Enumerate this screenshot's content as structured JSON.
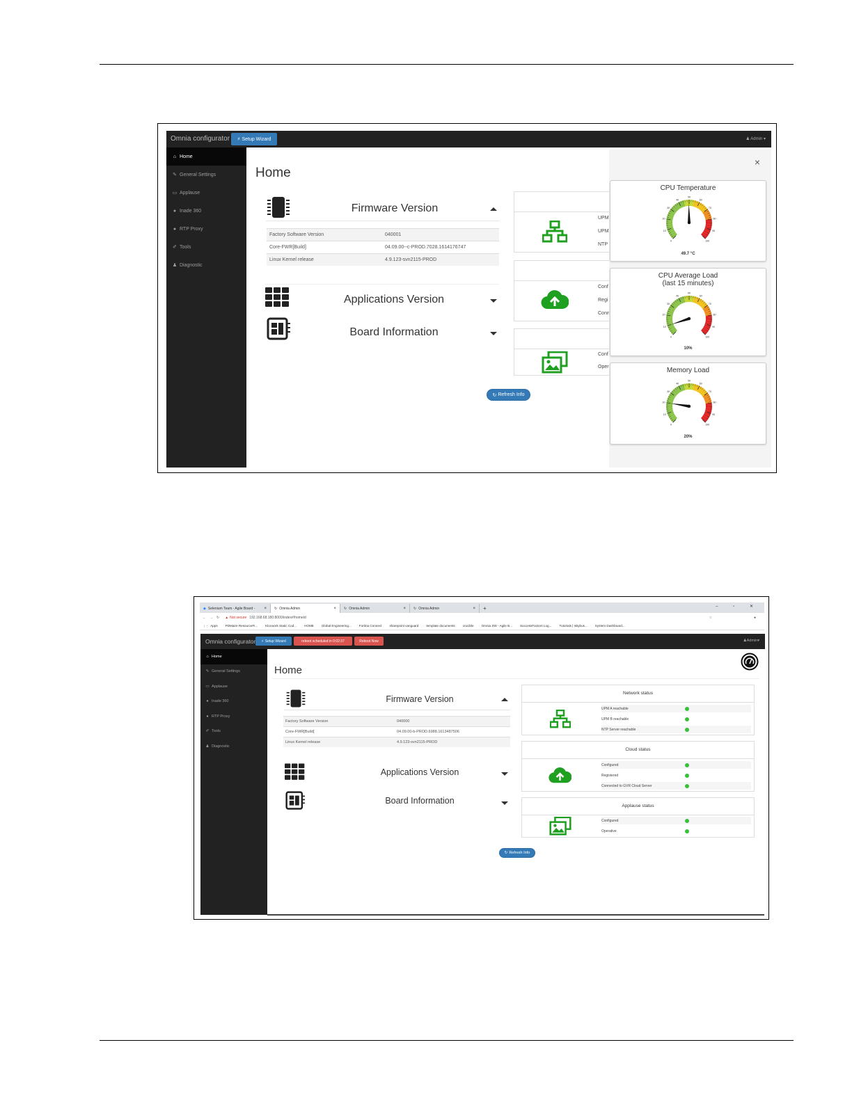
{
  "screenshot1": {
    "brand": "Omnia configurator",
    "setup_wizard": "Setup Wizard",
    "admin": "Admin",
    "sidebar": [
      {
        "label": "Home",
        "icon": "home-icon"
      },
      {
        "label": "General Settings",
        "icon": "wrench-icon"
      },
      {
        "label": "Applause",
        "icon": "monitor-icon"
      },
      {
        "label": "Inade 360",
        "icon": "circle-icon"
      },
      {
        "label": "RTP Proxy",
        "icon": "circle-icon"
      },
      {
        "label": "Tools",
        "icon": "edit-icon"
      },
      {
        "label": "Diagnostic",
        "icon": "user-icon"
      }
    ],
    "page_title": "Home",
    "firmware": {
      "title": "Firmware Version",
      "rows": [
        {
          "key": "Factory Software Version",
          "value": "040001"
        },
        {
          "key": "Core-FWR[Build]",
          "value": "04.09.00--c-PROD.7028.1614176747"
        },
        {
          "key": "Linux Kernel release",
          "value": "4.9.123-svn2115-PROD"
        }
      ]
    },
    "applications_title": "Applications Version",
    "board_title": "Board Information",
    "refresh": "Refresh Info",
    "status_fragments": {
      "network": [
        "UPM",
        "UPM",
        "NTP"
      ],
      "cloud": [
        "Conf",
        "Regi",
        "Conn"
      ],
      "applause": [
        "Conf",
        "Oper"
      ]
    },
    "gauges": [
      {
        "title": "CPU Temperature",
        "subtitle": "",
        "value_label": "49.7 °C",
        "fraction": 0.497,
        "ticks": [
          "0",
          "10",
          "20",
          "30",
          "40",
          "50",
          "60",
          "70",
          "80",
          "90",
          "100"
        ]
      },
      {
        "title": "CPU Average Load",
        "subtitle": "(last 15 minutes)",
        "value_label": "10%",
        "fraction": 0.1,
        "ticks": [
          "0",
          "10",
          "20",
          "30",
          "40",
          "50",
          "60",
          "70",
          "80",
          "90",
          "100"
        ]
      },
      {
        "title": "Memory Load",
        "subtitle": "",
        "value_label": "20%",
        "fraction": 0.2,
        "ticks": [
          "0",
          "10",
          "20",
          "30",
          "40",
          "50",
          "60",
          "70",
          "80",
          "90",
          "100"
        ]
      }
    ],
    "close": "×"
  },
  "screenshot2": {
    "browser_tabs": [
      {
        "label": "Selenium Team - Agile Board -",
        "active": false
      },
      {
        "label": "Omnia Admin",
        "active": true
      },
      {
        "label": "Omnia Admin",
        "active": false
      },
      {
        "label": "Omnia Admin",
        "active": false
      }
    ],
    "new_tab": "+",
    "window_controls": "– ▫ ✕",
    "not_secure": "Not secure",
    "url": "192.168.68.180:8000/index#/homeId",
    "bookmarks": [
      "Apps",
      "PDMaire ResourceFi...",
      "Klocwork Static Cod...",
      "HOME",
      "Global Engineering...",
      "Fortina Connect",
      "sharepoint vanguard",
      "template documents",
      "crucible",
      "Omnia SW - Agile B...",
      "SuccessFactors Log...",
      "Tutorials | nBybus...",
      "System Dashboard..."
    ],
    "brand": "Omnia configurator",
    "setup_wizard": "Setup Wizard",
    "reboot_scheduled": "reboot scheduled in 0:02:37",
    "reboot_now": "Reboot Now",
    "admin": "Admin",
    "sidebar": [
      {
        "label": "Home",
        "icon": "home-icon"
      },
      {
        "label": "General Settings",
        "icon": "wrench-icon"
      },
      {
        "label": "Applause",
        "icon": "monitor-icon"
      },
      {
        "label": "Inade 360",
        "icon": "circle-icon"
      },
      {
        "label": "RTP Proxy",
        "icon": "circle-icon"
      },
      {
        "label": "Tools",
        "icon": "edit-icon"
      },
      {
        "label": "Diagnostic",
        "icon": "user-icon"
      }
    ],
    "page_title": "Home",
    "firmware": {
      "title": "Firmware Version",
      "rows": [
        {
          "key": "Factory Software Version",
          "value": "040000"
        },
        {
          "key": "Core-FWR[Build]",
          "value": "04.09.00-b-PROD.6988.1613487506"
        },
        {
          "key": "Linux Kernel release",
          "value": "4.9.123-svn2115-PROD"
        }
      ]
    },
    "applications_title": "Applications Version",
    "board_title": "Board Information",
    "refresh": "Refresh Info",
    "network": {
      "title": "Network status",
      "items": [
        "UPM A reachable",
        "UPM B reachable",
        "NTP Server reachable"
      ]
    },
    "cloud": {
      "title": "Cloud status",
      "items": [
        "Configured",
        "Registered",
        "Connected to GVR Cloud Server"
      ]
    },
    "applause": {
      "title": "Applause status",
      "items": [
        "Configured",
        "Operative"
      ]
    },
    "status_color": "#3bbf3b",
    "icon_color": "#20a020"
  }
}
